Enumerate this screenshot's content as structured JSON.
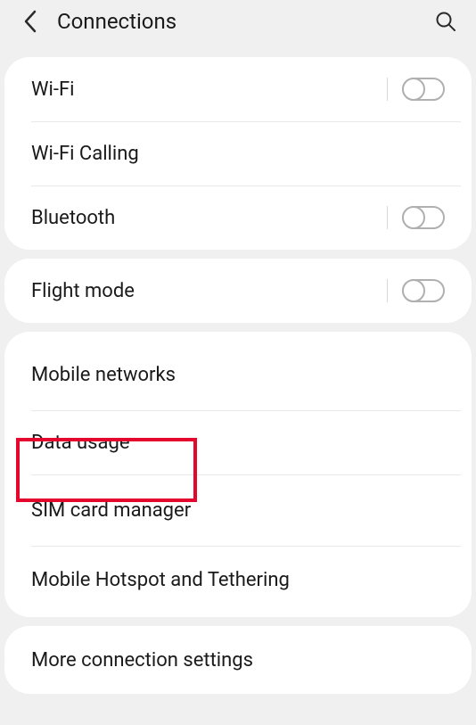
{
  "header": {
    "title": "Connections"
  },
  "groups": [
    {
      "id": "g1",
      "items": [
        {
          "id": "wifi",
          "label": "Wi-Fi",
          "has_toggle": true,
          "toggle_on": false
        },
        {
          "id": "wifi_calling",
          "label": "Wi-Fi Calling",
          "has_toggle": false
        },
        {
          "id": "bluetooth",
          "label": "Bluetooth",
          "has_toggle": true,
          "toggle_on": false
        }
      ]
    },
    {
      "id": "g2",
      "items": [
        {
          "id": "flight_mode",
          "label": "Flight mode",
          "has_toggle": true,
          "toggle_on": false
        }
      ]
    },
    {
      "id": "g3",
      "items": [
        {
          "id": "mobile_networks",
          "label": "Mobile networks",
          "has_toggle": false
        },
        {
          "id": "data_usage",
          "label": "Data usage",
          "has_toggle": false,
          "highlighted": true
        },
        {
          "id": "sim_card_manager",
          "label": "SIM card manager",
          "has_toggle": false
        },
        {
          "id": "hotspot_tether",
          "label": "Mobile Hotspot and Tethering",
          "has_toggle": false
        }
      ]
    },
    {
      "id": "g4",
      "items": [
        {
          "id": "more_conn",
          "label": "More connection settings",
          "has_toggle": false
        }
      ]
    }
  ],
  "highlight_color": "#e4062d"
}
